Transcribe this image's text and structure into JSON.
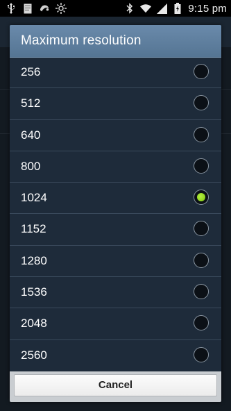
{
  "status_bar": {
    "time": "9:15 pm",
    "left_icons": [
      "usb-icon",
      "document-icon",
      "tool-icon",
      "brightness-icon"
    ],
    "right_icons": [
      "bluetooth-icon",
      "wifi-icon",
      "signal-icon",
      "battery-icon"
    ]
  },
  "dialog": {
    "title": "Maximum resolution",
    "options": [
      {
        "label": "256",
        "selected": false
      },
      {
        "label": "512",
        "selected": false
      },
      {
        "label": "640",
        "selected": false
      },
      {
        "label": "800",
        "selected": false
      },
      {
        "label": "1024",
        "selected": true
      },
      {
        "label": "1152",
        "selected": false
      },
      {
        "label": "1280",
        "selected": false
      },
      {
        "label": "1536",
        "selected": false
      },
      {
        "label": "2048",
        "selected": false
      },
      {
        "label": "2560",
        "selected": false
      }
    ],
    "cancel_label": "Cancel"
  },
  "colors": {
    "header": "#5f7f9f",
    "dialog_bg": "#1e2b3a",
    "selected_radio": "#8fd91f"
  }
}
